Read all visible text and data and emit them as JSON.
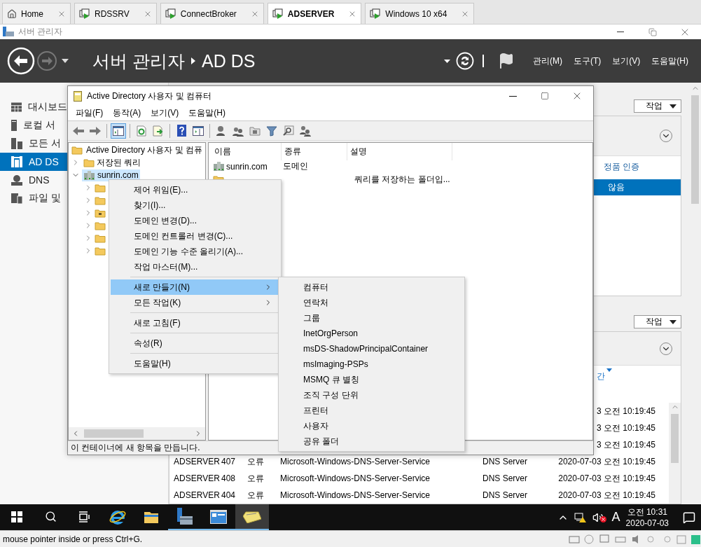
{
  "vm_tabs": [
    {
      "label": "Home",
      "kind": "home",
      "selected": false
    },
    {
      "label": "RDSSRV",
      "kind": "vm",
      "selected": false
    },
    {
      "label": "ConnectBroker",
      "kind": "vm",
      "selected": false
    },
    {
      "label": "ADSERVER",
      "kind": "vm",
      "selected": true
    },
    {
      "label": "Windows 10 x64",
      "kind": "vm",
      "selected": false
    }
  ],
  "server_manager": {
    "window_title": "서버 관리자",
    "breadcrumb_root": "서버 관리자",
    "breadcrumb_page": "AD DS",
    "menu": [
      "관리(M)",
      "도구(T)",
      "보기(V)",
      "도움말(H)"
    ],
    "sidebar": [
      {
        "label": "대시보드",
        "kind": "dashboard",
        "selected": false
      },
      {
        "label": "로컬 서",
        "kind": "server",
        "selected": false
      },
      {
        "label": "모든 서",
        "kind": "servers",
        "selected": false
      },
      {
        "label": "AD DS",
        "kind": "adds",
        "selected": true
      },
      {
        "label": "DNS",
        "kind": "dns",
        "selected": false
      },
      {
        "label": "파일 및",
        "kind": "files",
        "selected": false
      }
    ],
    "sections": [
      {
        "tasks": "작업",
        "column": {
          "label": "정품 인증"
        },
        "rows": [
          {
            "value": "않음",
            "selected": true
          }
        ]
      },
      {
        "tasks": "작업",
        "column": {
          "label": "간",
          "sorted": true
        },
        "events": [
          {
            "date": "3 오전 10:19:45"
          },
          {
            "date": "3 오전 10:19:45"
          },
          {
            "date": "3 오전 10:19:45"
          },
          {
            "server": "ADSERVER",
            "id": "407",
            "level": "오류",
            "source": "Microsoft-Windows-DNS-Server-Service",
            "category": "DNS Server",
            "date": "2020-07-03 오전 10:19:45"
          },
          {
            "server": "ADSERVER",
            "id": "408",
            "level": "오류",
            "source": "Microsoft-Windows-DNS-Server-Service",
            "category": "DNS Server",
            "date": "2020-07-03 오전 10:19:45"
          },
          {
            "server": "ADSERVER",
            "id": "404",
            "level": "오류",
            "source": "Microsoft-Windows-DNS-Server-Service",
            "category": "DNS Server",
            "date": "2020-07-03 오전 10:19:45"
          }
        ]
      }
    ]
  },
  "aduc": {
    "title": "Active Directory 사용자 및 컴퓨터",
    "menu": [
      "파일(F)",
      "동작(A)",
      "보기(V)",
      "도움말(H)"
    ],
    "toolbar": [
      {
        "kind": "back",
        "pressed": false
      },
      {
        "kind": "forward",
        "pressed": false
      },
      {
        "kind": "separator"
      },
      {
        "kind": "tree",
        "pressed": true
      },
      {
        "kind": "separator"
      },
      {
        "kind": "refresh",
        "pressed": false
      },
      {
        "kind": "export",
        "pressed": false
      },
      {
        "kind": "separator"
      },
      {
        "kind": "help",
        "pressed": false
      },
      {
        "kind": "pane",
        "pressed": false
      },
      {
        "kind": "separator"
      },
      {
        "kind": "user",
        "pressed": false
      },
      {
        "kind": "group",
        "pressed": false
      },
      {
        "kind": "ou",
        "pressed": false
      },
      {
        "kind": "filter",
        "pressed": false
      },
      {
        "kind": "find",
        "pressed": false
      },
      {
        "kind": "group-add",
        "pressed": false
      }
    ],
    "tree": {
      "label": "Active Directory 사용자 및 컴퓨",
      "children": [
        {
          "label": "저장된 쿼리",
          "kind": "folder",
          "expanded": false,
          "selected": false
        },
        {
          "label": "sunrin.com",
          "kind": "domain",
          "expanded": true,
          "selected": true,
          "children": [
            {
              "kind": "folder",
              "expanded": false
            },
            {
              "kind": "folder",
              "expanded": false
            },
            {
              "kind": "special",
              "expanded": false
            },
            {
              "kind": "folder",
              "expanded": false
            },
            {
              "kind": "folder",
              "expanded": false
            },
            {
              "kind": "folder",
              "expanded": false
            }
          ]
        }
      ]
    },
    "columns": [
      "이름",
      "종류",
      "설명"
    ],
    "rows": [
      {
        "kind": "domain",
        "name": "sunrin.com",
        "type": "도메인"
      },
      {
        "kind": "folder",
        "description": "쿼리를 저장하는 폴더입..."
      }
    ],
    "status": "이 컨테이너에 새 항목을 만듭니다."
  },
  "context_menu": [
    {
      "kind": "item",
      "label": "제어 위임(E)...",
      "submenu": false,
      "selected": false
    },
    {
      "kind": "item",
      "label": "찾기(I)...",
      "submenu": false,
      "selected": false
    },
    {
      "kind": "item",
      "label": "도메인 변경(D)...",
      "submenu": false,
      "selected": false
    },
    {
      "kind": "item",
      "label": "도메인 컨트롤러 변경(C)...",
      "submenu": false,
      "selected": false
    },
    {
      "kind": "item",
      "label": "도메인 기능 수준 올리기(A)...",
      "submenu": false,
      "selected": false
    },
    {
      "kind": "item",
      "label": "작업 마스터(M)...",
      "submenu": false,
      "selected": false
    },
    {
      "kind": "separator"
    },
    {
      "kind": "item",
      "label": "새로 만들기(N)",
      "submenu": true,
      "selected": true
    },
    {
      "kind": "item",
      "label": "모든 작업(K)",
      "submenu": true,
      "selected": false
    },
    {
      "kind": "separator"
    },
    {
      "kind": "item",
      "label": "새로 고침(F)",
      "submenu": false,
      "selected": false
    },
    {
      "kind": "separator"
    },
    {
      "kind": "item",
      "label": "속성(R)",
      "submenu": false,
      "selected": false
    },
    {
      "kind": "separator"
    },
    {
      "kind": "item",
      "label": "도움말(H)",
      "submenu": false,
      "selected": false
    }
  ],
  "submenu": [
    "컴퓨터",
    "연락처",
    "그룹",
    "InetOrgPerson",
    "msDS-ShadowPrincipalContainer",
    "msImaging-PSPs",
    "MSMQ 큐 별칭",
    "조직 구성 단위",
    "프린터",
    "사용자",
    "공유 폴더"
  ],
  "taskbar": {
    "apps": [
      {
        "kind": "start",
        "running": false,
        "selected": false
      },
      {
        "kind": "search",
        "running": false,
        "selected": false
      },
      {
        "kind": "taskview",
        "running": false,
        "selected": false
      },
      {
        "kind": "browser",
        "running": false,
        "selected": false
      },
      {
        "kind": "explorer",
        "running": false,
        "selected": false
      },
      {
        "kind": "servermanager",
        "running": true,
        "selected": false
      },
      {
        "kind": "console",
        "running": true,
        "selected": false
      },
      {
        "kind": "aduc",
        "running": true,
        "selected": true
      }
    ],
    "ime": "A",
    "volume_muted": true,
    "time": "오전 10:31",
    "date": "2020-07-03"
  },
  "vm_status": "mouse pointer inside or press Ctrl+G."
}
